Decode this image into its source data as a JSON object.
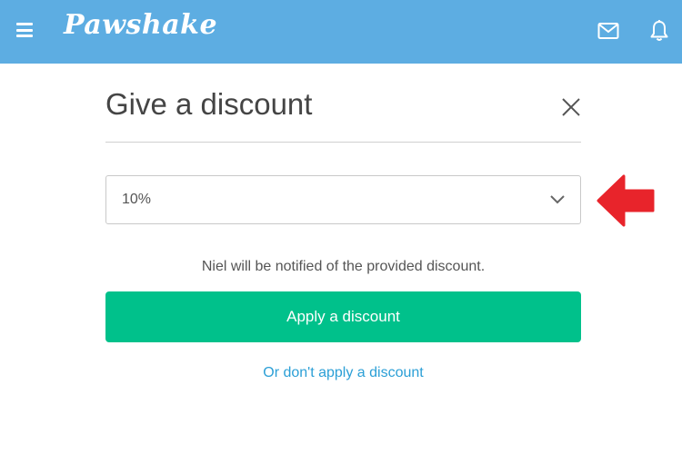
{
  "header": {
    "brand": "Pawshake",
    "background_color": "#5dade2",
    "icons": [
      "menu-icon",
      "mail-icon",
      "bell-icon"
    ]
  },
  "modal": {
    "title": "Give a discount",
    "close_icon": "close-icon",
    "select": {
      "selected_value": "10%",
      "chevron_icon": "chevron-down-icon"
    },
    "notice": "Niel will be notified of the provided discount.",
    "apply_label": "Apply a discount",
    "apply_color": "#00c18b",
    "skip_label": "Or don't apply a discount",
    "link_color": "#2b9fd6"
  },
  "annotation": {
    "icon": "arrow-left-icon",
    "color": "#e8242b"
  }
}
